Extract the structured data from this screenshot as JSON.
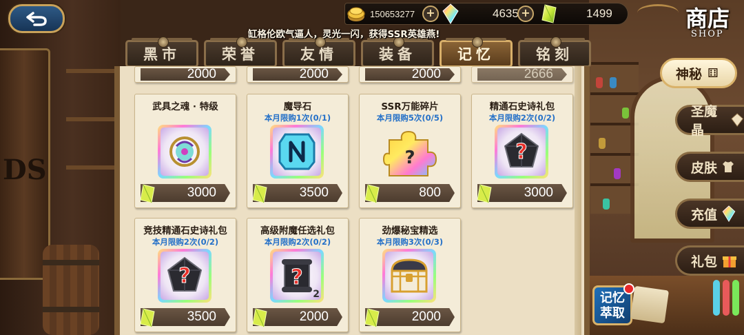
{
  "header": {
    "gold": "150653277",
    "rainbow_gems": "4635",
    "memory_gems": "1499",
    "marquee": "缸格伦欧气逼人，灵光一闪，获得SSR英雄燕!",
    "shop_title_cn": "商店",
    "shop_title_en": "SHOP"
  },
  "tabs": [
    {
      "label": "黑市",
      "active": false
    },
    {
      "label": "荣誉",
      "active": false
    },
    {
      "label": "友情",
      "active": false
    },
    {
      "label": "装备",
      "active": false
    },
    {
      "label": "记忆",
      "active": true
    },
    {
      "label": "铭刻",
      "active": false
    }
  ],
  "partial_row": [
    {
      "price": "2000"
    },
    {
      "price": "2000"
    },
    {
      "price": "2000"
    },
    {
      "price": "2666"
    }
  ],
  "items": [
    {
      "name": "武具之魂 · 特级",
      "limit": "",
      "price": "3000",
      "icon": "weapon-soul-icon"
    },
    {
      "name": "魔导石",
      "limit": "本月限购1次(0/1)",
      "price": "3500",
      "icon": "magic-stone-icon"
    },
    {
      "name": "SSR万能碎片",
      "limit": "本月限购5次(0/5)",
      "price": "800",
      "icon": "puzzle-piece-icon"
    },
    {
      "name": "精通石史诗礼包",
      "limit": "本月限购2次(0/2)",
      "price": "3000",
      "icon": "mystery-gem-icon"
    },
    {
      "name": "竞技精通石史诗礼包",
      "limit": "本月限购2次(0/2)",
      "price": "3500",
      "icon": "mystery-gem-icon"
    },
    {
      "name": "高级附魔任选礼包",
      "limit": "本月限购2次(0/2)",
      "price": "2000",
      "icon": "mystery-scroll-icon",
      "count": "2"
    },
    {
      "name": "劲爆秘宝精选",
      "limit": "本月限购3次(0/3)",
      "price": "2000",
      "icon": "treasure-chest-icon"
    }
  ],
  "side_nav": [
    {
      "label": "神秘",
      "glyph": "⚅",
      "active": true
    },
    {
      "label": "圣魔晶",
      "glyph": "",
      "active": false
    },
    {
      "label": "皮肤",
      "glyph": "",
      "active": false
    },
    {
      "label": "充值",
      "glyph": "",
      "active": false
    },
    {
      "label": "礼包",
      "glyph": "",
      "active": false
    }
  ],
  "memory_extract": {
    "label_line1": "记忆",
    "label_line2": "萃取"
  },
  "colors": {
    "limit_text": "#2470c8",
    "active_tab": "#8a6436",
    "panel_bg": "#ecdfc4"
  }
}
